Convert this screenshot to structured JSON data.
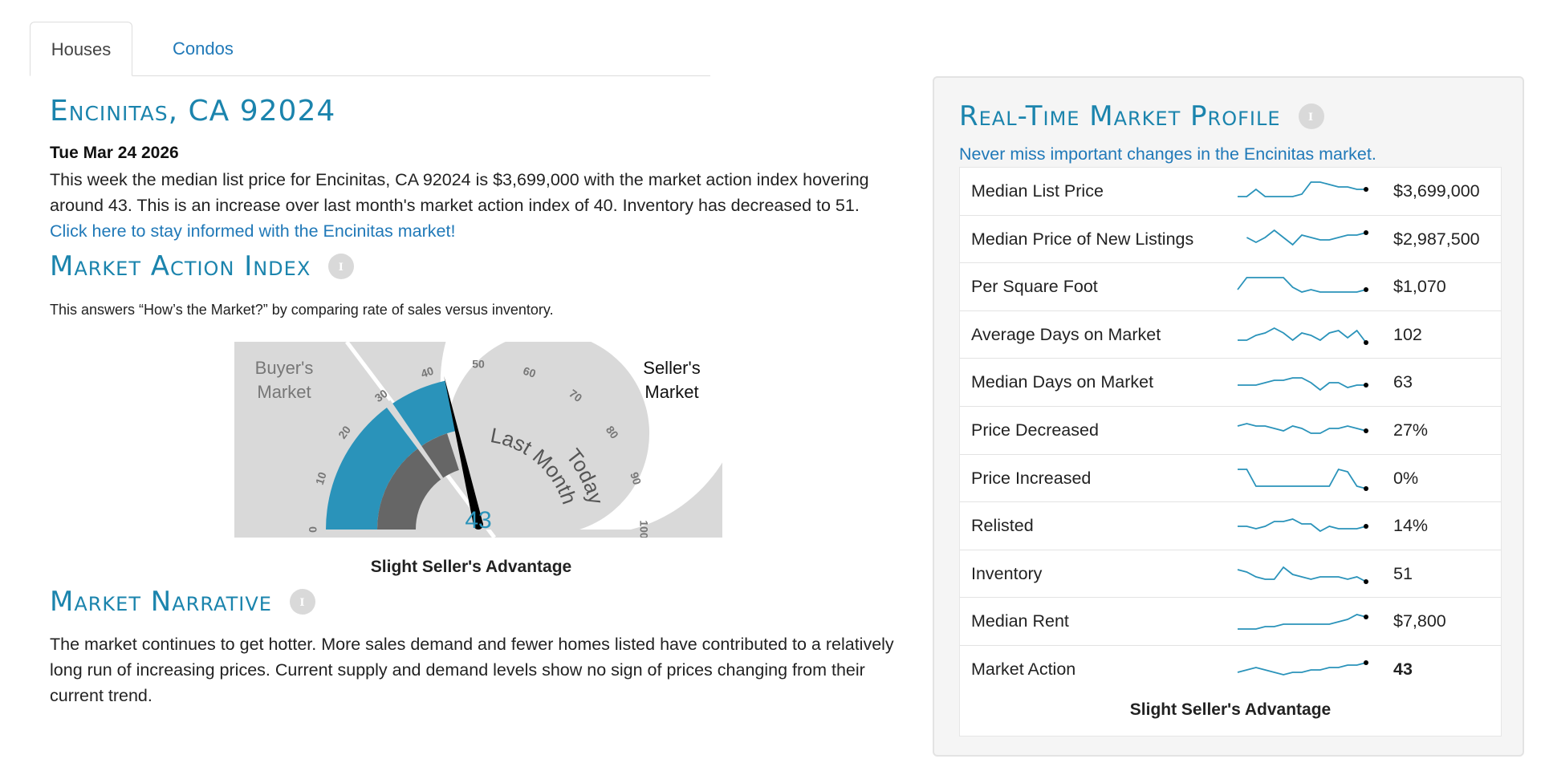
{
  "tabs": [
    {
      "label": "Houses",
      "active": true
    },
    {
      "label": "Condos",
      "active": false
    }
  ],
  "location_title": "Encinitas, CA 92024",
  "date": "Tue Mar 24 2026",
  "summary_text": "This week the median list price for Encinitas, CA 92024 is $3,699,000 with the market action index hovering around 43. This is an increase over last month's market action index of 40. Inventory has decreased to 51. ",
  "summary_link": "Click here to stay informed with the Encinitas market!",
  "market_action": {
    "title": "Market Action Index",
    "description": "This answers “How’s the Market?” by comparing rate of sales versus inventory.",
    "gauge": {
      "value": 43,
      "value_label": "43",
      "last_month_value": 40,
      "scale_min": 0,
      "scale_max": 100,
      "ticks": [
        "0",
        "10",
        "20",
        "30",
        "40",
        "50",
        "60",
        "70",
        "80",
        "90",
        "100"
      ],
      "buyers_label_line1": "Buyer's",
      "buyers_label_line2": "Market",
      "sellers_label_line1": "Seller's",
      "sellers_label_line2": "Market",
      "last_month_label": "Last Month",
      "today_label": "Today",
      "colors": {
        "accent": "#2a93ba",
        "dark_gray": "#666666",
        "light_gray": "#d9d9d9",
        "needle": "#000000"
      }
    },
    "caption": "Slight Seller's Advantage"
  },
  "narrative": {
    "title": "Market Narrative",
    "text": "The market continues to get hotter. More sales demand and fewer homes listed have contributed to a relatively long run of increasing prices. Current supply and demand levels show no sign of prices changing from their current trend."
  },
  "profile": {
    "title": "Real-Time Market Profile",
    "subtitle": "Never miss important changes in the Encinitas market.",
    "rows": [
      {
        "label": "Median List Price",
        "value": "$3,699,000",
        "bold": false,
        "trend": [
          3,
          3,
          6,
          3,
          3,
          3,
          3,
          4,
          9,
          9,
          8,
          7,
          7,
          6,
          6
        ]
      },
      {
        "label": "Median Price of New Listings",
        "value": "$2,987,500",
        "bold": false,
        "trend": [
          null,
          6,
          4,
          6,
          9,
          6,
          3,
          7,
          6,
          5,
          5,
          6,
          7,
          7,
          8
        ]
      },
      {
        "label": "Per Square Foot",
        "value": "$1,070",
        "bold": false,
        "trend": [
          4,
          9,
          9,
          9,
          9,
          9,
          5,
          3,
          4,
          3,
          3,
          3,
          3,
          3,
          4
        ]
      },
      {
        "label": "Average Days on Market",
        "value": "102",
        "bold": false,
        "trend": [
          3,
          3,
          5,
          6,
          8,
          6,
          3,
          6,
          5,
          3,
          6,
          7,
          4,
          7,
          2
        ]
      },
      {
        "label": "Median Days on Market",
        "value": "63",
        "bold": false,
        "trend": [
          4,
          4,
          4,
          5,
          6,
          6,
          7,
          7,
          5,
          2,
          5,
          5,
          3,
          4,
          4
        ]
      },
      {
        "label": "Price Decreased",
        "value": "27%",
        "bold": false,
        "trend": [
          7,
          8,
          7,
          7,
          6,
          5,
          7,
          6,
          4,
          4,
          6,
          6,
          7,
          6,
          5
        ]
      },
      {
        "label": "Price Increased",
        "value": "0%",
        "bold": false,
        "trend": [
          9,
          9,
          2,
          2,
          2,
          2,
          2,
          2,
          2,
          2,
          2,
          9,
          8,
          2,
          1
        ]
      },
      {
        "label": "Relisted",
        "value": "14%",
        "bold": false,
        "trend": [
          5,
          5,
          4,
          5,
          7,
          7,
          8,
          6,
          6,
          3,
          5,
          4,
          4,
          4,
          5
        ]
      },
      {
        "label": "Inventory",
        "value": "51",
        "bold": false,
        "trend": [
          7,
          6,
          4,
          3,
          3,
          8,
          5,
          4,
          3,
          4,
          4,
          4,
          3,
          4,
          2
        ]
      },
      {
        "label": "Median Rent",
        "value": "$7,800",
        "bold": false,
        "trend": [
          2,
          2,
          2,
          3,
          3,
          4,
          4,
          4,
          4,
          4,
          4,
          5,
          6,
          8,
          7
        ]
      },
      {
        "label": "Market Action",
        "value": "43",
        "bold": true,
        "trend": [
          4,
          5,
          6,
          5,
          4,
          3,
          4,
          4,
          5,
          5,
          6,
          6,
          7,
          7,
          8
        ]
      }
    ],
    "caption": "Slight Seller's Advantage",
    "spark_color": "#2a93ba"
  }
}
